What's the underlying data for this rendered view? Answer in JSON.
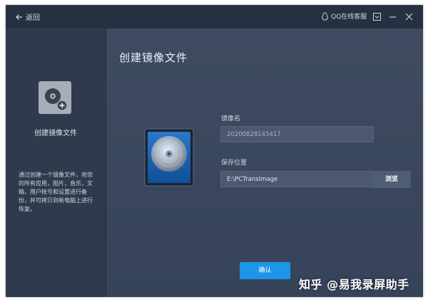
{
  "titlebar": {
    "back_label": "返回",
    "support_label": "QQ在线客服"
  },
  "sidebar": {
    "title": "创建镜像文件",
    "description": "通过创建一个镜像文件，将您的所有应用，图片，音乐，文稿，用户帐号和设置进行备份，并可拷贝到新电脑上进行恢复。"
  },
  "main": {
    "title": "创建镜像文件",
    "image_name_label": "镜像名",
    "image_name_value": "20200828145417",
    "save_location_label": "保存位置",
    "save_location_value": "E:\\PCTransImage",
    "browse_label": "浏览",
    "confirm_label": "确认"
  },
  "watermark": "知乎 @易我录屏助手",
  "colors": {
    "accent": "#1e95e8",
    "titlebar": "#263041",
    "sidebar": "#2f3a4d",
    "main": "#3e4b61"
  },
  "icons": [
    "back-arrow-icon",
    "qq-penguin-icon",
    "minimize-to-tray-icon",
    "minimize-icon",
    "close-icon",
    "disk-image-icon",
    "add-badge-icon"
  ]
}
